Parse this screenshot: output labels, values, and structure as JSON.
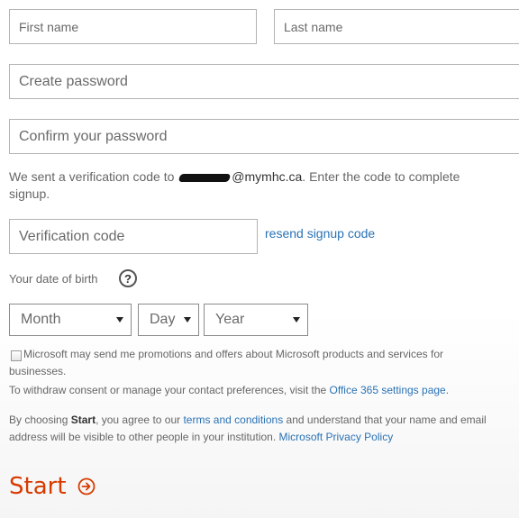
{
  "fields": {
    "first_name_placeholder": "First name",
    "last_name_placeholder": "Last name",
    "create_password_placeholder": "Create password",
    "confirm_password_placeholder": "Confirm your password",
    "verification_code_placeholder": "Verification code"
  },
  "verification": {
    "text_before": "We sent a verification code to ",
    "email_domain": "@mymhc.ca",
    "text_after": ". Enter the code to complete signup.",
    "resend_link": "resend signup code"
  },
  "dob": {
    "label": "Your date of birth",
    "help_icon": "question-circle-icon",
    "help_glyph": "?",
    "month": "Month",
    "day": "Day",
    "year": "Year"
  },
  "consent": {
    "checkbox_label": "Microsoft may send me promotions and offers about Microsoft products and services for businesses.",
    "withdraw_text": "To withdraw consent or manage your contact preferences, visit the ",
    "settings_link": "Office 365 settings page",
    "period": "."
  },
  "terms": {
    "prefix": "By choosing ",
    "start_word": "Start",
    "middle": ", you agree to our ",
    "terms_link": "terms and conditions",
    "suffix": " and understand that your name and email address will be visible to other people in your institution. ",
    "privacy_link": "Microsoft Privacy Policy"
  },
  "start": {
    "label": "Start",
    "icon": "arrow-circle-right-icon"
  },
  "colors": {
    "accent": "#d83b01",
    "link": "#2a72b5"
  }
}
